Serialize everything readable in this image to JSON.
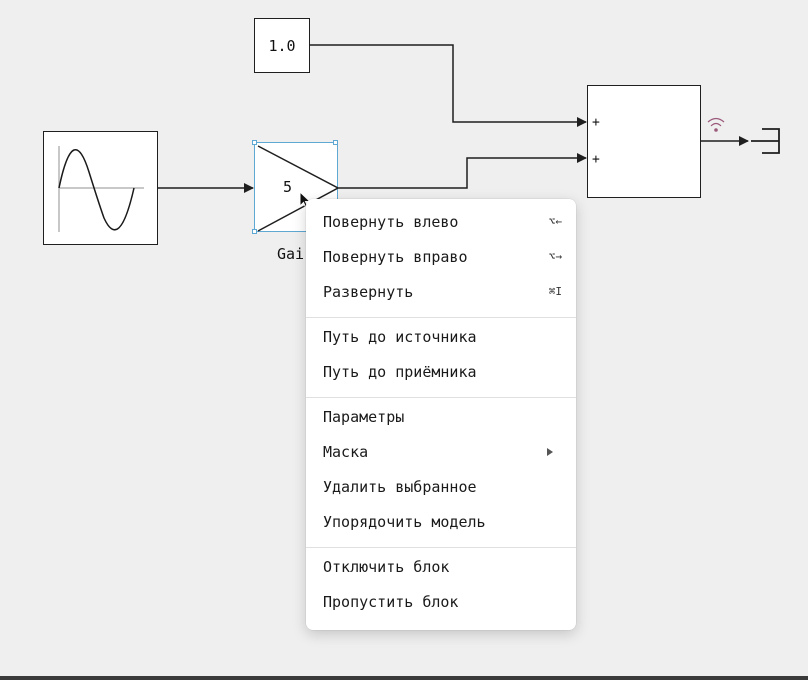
{
  "diagram": {
    "constant_block": {
      "value": "1.0"
    },
    "gain_block": {
      "value": "5",
      "label": "Gai"
    },
    "sum_block": {
      "ports": [
        "+",
        "+"
      ]
    }
  },
  "context_menu": {
    "groups": [
      [
        {
          "label": "Повернуть влево",
          "shortcut": "⌥←"
        },
        {
          "label": "Повернуть вправо",
          "shortcut": "⌥→"
        },
        {
          "label": "Развернуть",
          "shortcut": "⌘I"
        }
      ],
      [
        {
          "label": "Путь до источника"
        },
        {
          "label": "Путь до приёмника"
        }
      ],
      [
        {
          "label": "Параметры"
        },
        {
          "label": "Маска",
          "submenu": true
        },
        {
          "label": "Удалить выбранное"
        },
        {
          "label": "Упорядочить модель"
        }
      ],
      [
        {
          "label": "Отключить блок"
        },
        {
          "label": "Пропустить блок"
        }
      ]
    ]
  },
  "colors": {
    "selection": "#5fa8d3",
    "signal_icon": "#9b5a7a",
    "background": "#efefef"
  },
  "icons": [
    "sine-wave-icon",
    "signal-strength-icon",
    "terminator-icon",
    "mouse-cursor-icon",
    "submenu-arrow-icon"
  ]
}
